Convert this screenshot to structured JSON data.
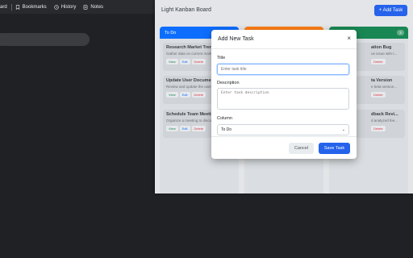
{
  "browser": {
    "items": [
      {
        "label": "ard",
        "icon": "none"
      },
      {
        "label": "Bookmarks",
        "icon": "bookmark-icon"
      },
      {
        "label": "History",
        "icon": "history-icon"
      },
      {
        "label": "Notes",
        "icon": "notes-icon"
      }
    ]
  },
  "app": {
    "title": "Light Kanban Board",
    "add_task_label": "+ Add Task",
    "accent_color": "#2563eb"
  },
  "columns": [
    {
      "name": "To Do",
      "color": "#0d6efd",
      "cards": [
        {
          "title": "Research Market Trends",
          "desc": "Gather data on current market",
          "actions": [
            "View",
            "Edit",
            "Delete"
          ]
        },
        {
          "title": "Update User Documentation",
          "desc": "Review and update the user",
          "actions": [
            "View",
            "Edit",
            "Delete"
          ]
        },
        {
          "title": "Schedule Team Meeting",
          "desc": "Organize a meeting to discuss",
          "actions": [
            "View",
            "Edit",
            "Delete"
          ]
        }
      ]
    },
    {
      "name": "",
      "color": "#fd7e14",
      "cards": []
    },
    {
      "name": "",
      "color": "#198754",
      "count": "3",
      "cards": [
        {
          "title": "ation Bug",
          "desc": "ue issue with t...",
          "actions": [
            "Delete"
          ]
        },
        {
          "title": "ta Version",
          "desc": "e beta version...",
          "actions": [
            "Delete"
          ]
        },
        {
          "title": "dback Revi...",
          "desc": "d analyzed fee...",
          "actions": [
            "Delete"
          ]
        }
      ]
    }
  ],
  "modal": {
    "title": "Add New Task",
    "close": "×",
    "title_label": "Title",
    "title_placeholder": "Enter task title",
    "desc_label": "Description",
    "desc_placeholder": "Enter task description",
    "column_label": "Column",
    "column_value": "To Do",
    "cancel_label": "Cancel",
    "save_label": "Save Task"
  }
}
